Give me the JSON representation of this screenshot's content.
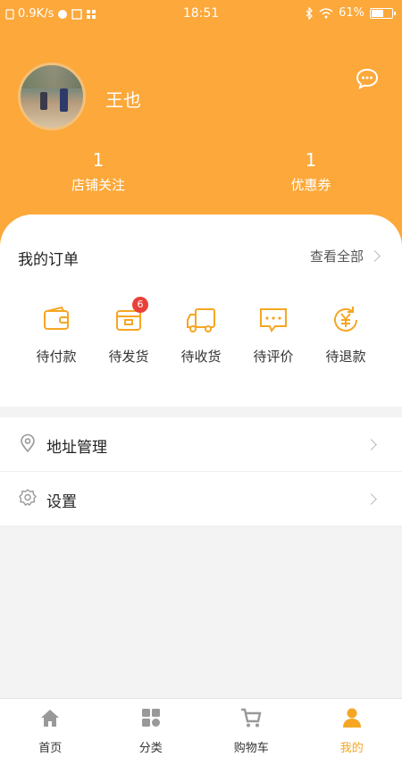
{
  "status_bar": {
    "network_speed": "0.9K/s",
    "time": "18:51",
    "battery": "61%",
    "battery_level": 0.61
  },
  "profile": {
    "username": "王也",
    "stats": [
      {
        "count": "1",
        "label": "店铺关注"
      },
      {
        "count": "1",
        "label": "优惠券"
      }
    ]
  },
  "orders": {
    "title": "我的订单",
    "view_all": "查看全部",
    "items": [
      {
        "label": "待付款",
        "icon": "wallet-icon"
      },
      {
        "label": "待发货",
        "icon": "package-icon",
        "badge": "6"
      },
      {
        "label": "待收货",
        "icon": "truck-icon"
      },
      {
        "label": "待评价",
        "icon": "comment-icon"
      },
      {
        "label": "待退款",
        "icon": "refund-yen-icon"
      }
    ]
  },
  "menu": [
    {
      "label": "地址管理",
      "icon": "location-pin-icon"
    },
    {
      "label": "设置",
      "icon": "gear-icon"
    }
  ],
  "tabbar": {
    "items": [
      {
        "label": "首页",
        "icon": "home-icon"
      },
      {
        "label": "分类",
        "icon": "grid-icon"
      },
      {
        "label": "购物车",
        "icon": "cart-icon"
      },
      {
        "label": "我的",
        "icon": "person-icon",
        "active": true
      }
    ]
  },
  "colors": {
    "accent": "#fca83a",
    "active_tab": "#f5a623",
    "badge": "#e8413a"
  }
}
